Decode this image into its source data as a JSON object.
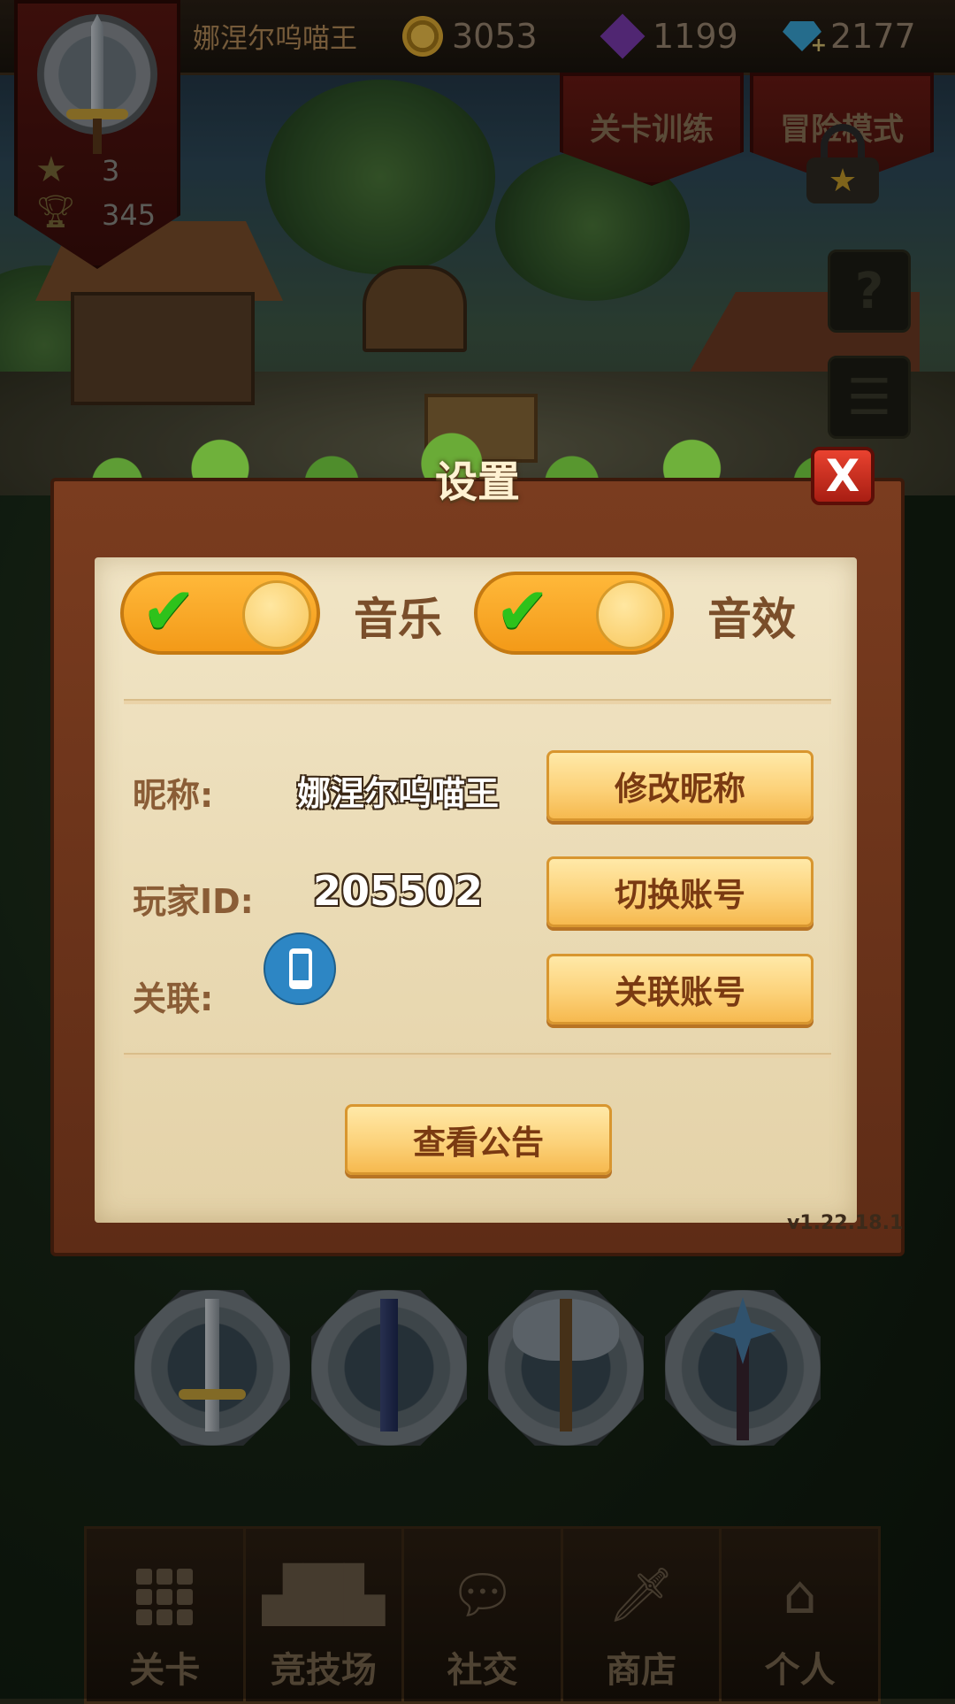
{
  "topbar": {
    "player_name": "娜涅尔呜喵王",
    "coins": "3053",
    "gems": "1199",
    "diamonds": "2177",
    "icons": [
      "coin-icon",
      "purple-gem-icon",
      "diamond-add-icon"
    ]
  },
  "badge": {
    "stars": "3",
    "trophies": "345",
    "icons": [
      "sword-emblem-icon",
      "star-icon",
      "trophy-icon"
    ]
  },
  "modes": {
    "training": "关卡训练",
    "adventure": "冒险模式"
  },
  "side_buttons": {
    "help_glyph": "?",
    "menu_glyph": "☰"
  },
  "dialog": {
    "title": "设置",
    "close_glyph": "X",
    "music_label": "音乐",
    "sfx_label": "音效",
    "music_on": true,
    "sfx_on": true,
    "check_glyph": "✔",
    "nickname_label": "昵称:",
    "nickname_value": "娜涅尔呜喵王",
    "change_nickname": "修改昵称",
    "player_id_label": "玩家ID:",
    "player_id_value": "205502",
    "switch_account": "切换账号",
    "link_label": "关联:",
    "link_account": "关联账号",
    "view_notice": "查看公告",
    "version": "v1.22.18.1"
  },
  "weapons": [
    "sword",
    "scepter",
    "battle-axe",
    "ice-staff"
  ],
  "nav": {
    "items": [
      {
        "label": "关卡",
        "icon": "grid-icon"
      },
      {
        "label": "竞技场",
        "icon": "podium-icon"
      },
      {
        "label": "社交",
        "icon": "chat-icon"
      },
      {
        "label": "商店",
        "icon": "shop-icon"
      },
      {
        "label": "个人",
        "icon": "home-icon"
      }
    ]
  },
  "colors": {
    "accent_orange": "#f39a18",
    "check_green": "#2ec21b",
    "close_red": "#e9422f",
    "button_gold": "#fcd27a",
    "frame_brown": "#7a3c1f"
  }
}
